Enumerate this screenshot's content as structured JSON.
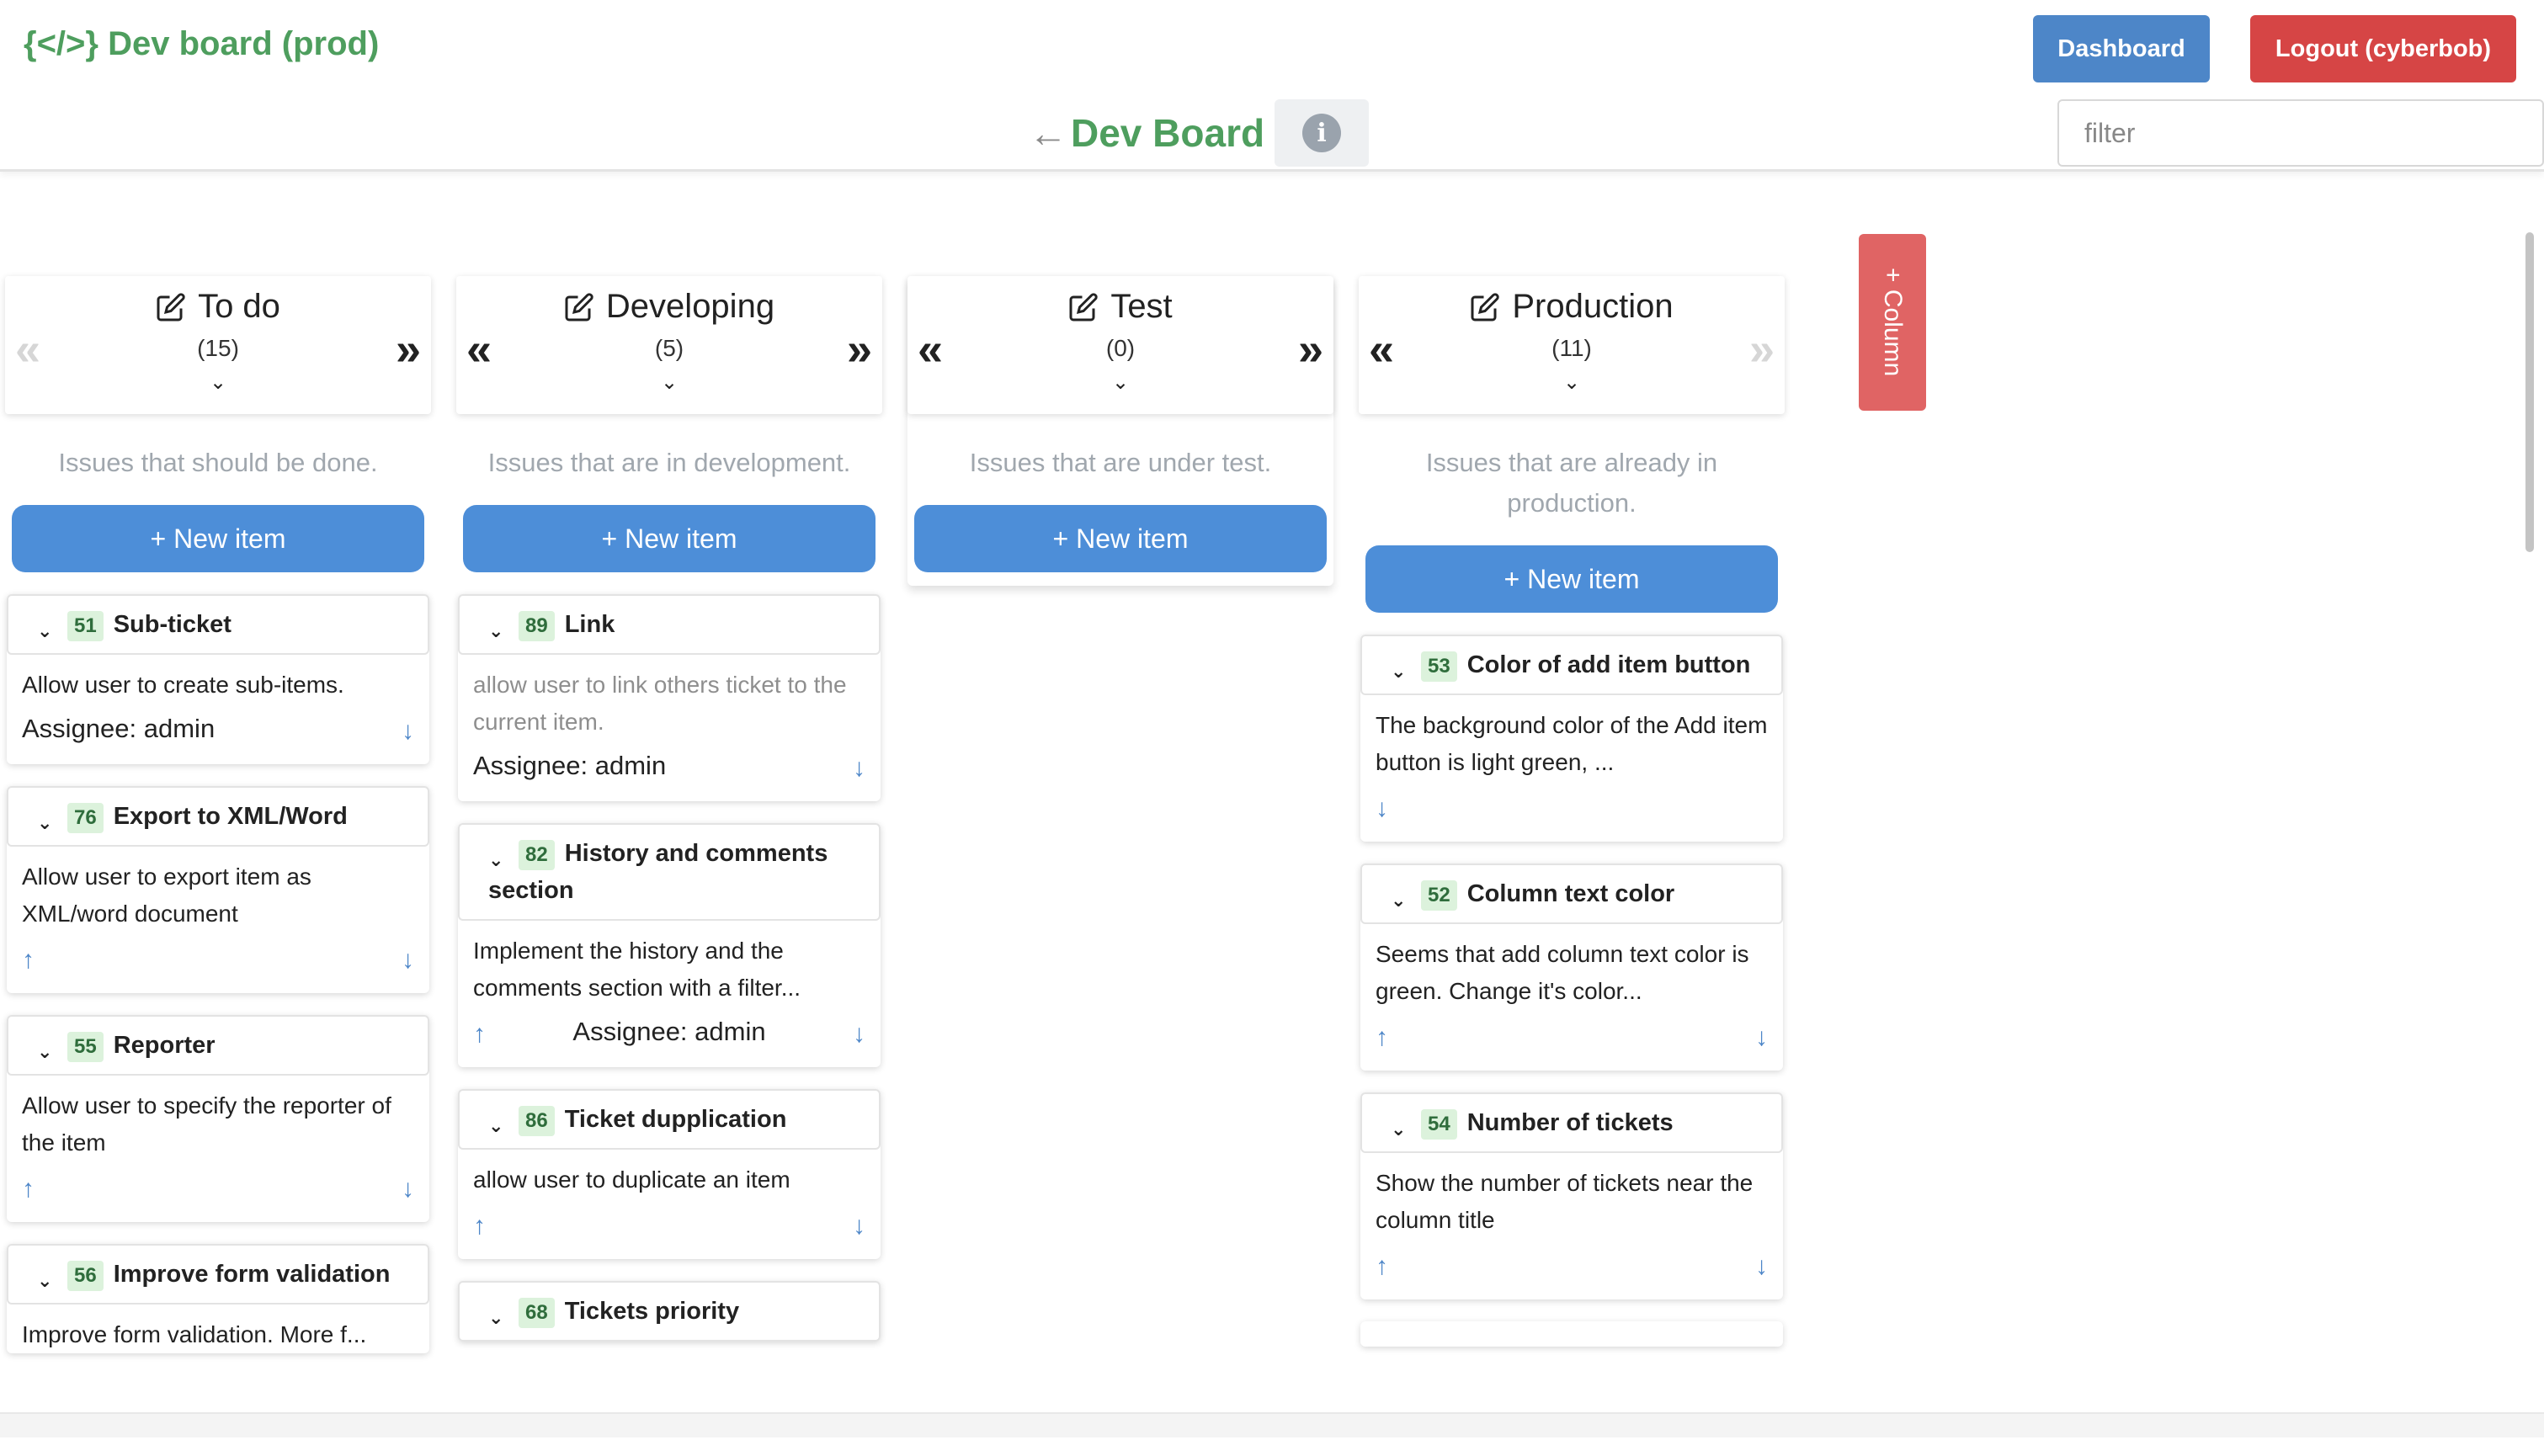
{
  "header": {
    "brand": "{</>} Dev board (prod)",
    "dashboard_label": "Dashboard",
    "logout_label": "Logout (cyberbob)",
    "board_title": "Dev Board",
    "back_glyph": "←",
    "info_glyph": "i",
    "filter_placeholder": "filter"
  },
  "add_column_label": "+ Column",
  "new_item_label": "+ New item",
  "columns": [
    {
      "title": "To do",
      "count": "(15)",
      "description": "Issues that should be done.",
      "items": [
        {
          "id": "51",
          "title": "Sub-ticket",
          "body": "Allow user to create sub-items.",
          "assignee": "Assignee: admin"
        },
        {
          "id": "76",
          "title": "Export to XML/Word",
          "body": "Allow user to export item as XML/word document"
        },
        {
          "id": "55",
          "title": "Reporter",
          "body": "Allow user to specify the reporter of the item"
        },
        {
          "id": "56",
          "title": "Improve form validation",
          "body": "Improve form validation. More f..."
        }
      ]
    },
    {
      "title": "Developing",
      "count": "(5)",
      "description": "Issues that are in development.",
      "items": [
        {
          "id": "89",
          "title": "Link",
          "body": "allow user to link others ticket to the current item.",
          "assignee": "Assignee: admin"
        },
        {
          "id": "82",
          "title": "History and comments section",
          "body": "Implement the history and the comments section with a filter...",
          "assignee": "Assignee: admin"
        },
        {
          "id": "86",
          "title": "Ticket dupplication",
          "body": "allow user to duplicate an item"
        },
        {
          "id": "68",
          "title": "Tickets priority"
        }
      ]
    },
    {
      "title": "Test",
      "count": "(0)",
      "description": "Issues that are under test.",
      "items": []
    },
    {
      "title": "Production",
      "count": "(11)",
      "description": "Issues that are already in production.",
      "items": [
        {
          "id": "53",
          "title": "Color of add item button",
          "body": "The background color of the Add item button is light green, ..."
        },
        {
          "id": "52",
          "title": "Column text color",
          "body": "Seems that add column text color is green. Change it's color..."
        },
        {
          "id": "54",
          "title": "Number of tickets",
          "body": "Show the number of tickets near the column title"
        }
      ]
    }
  ],
  "colors": {
    "brand_green": "#4e9e5e",
    "primary_blue": "#4d8ed8",
    "danger_red": "#d64545",
    "add_column_red": "#e06464",
    "id_badge_bg": "#dcf2dc"
  },
  "icons": {
    "edit": "edit-icon",
    "nav_prev": "double-chevron-left-icon",
    "nav_next": "double-chevron-right-icon",
    "move_up": "arrow-up-icon",
    "move_down": "arrow-down-icon",
    "expand": "chevron-down-icon",
    "info": "info-icon",
    "back": "arrow-left-icon"
  }
}
